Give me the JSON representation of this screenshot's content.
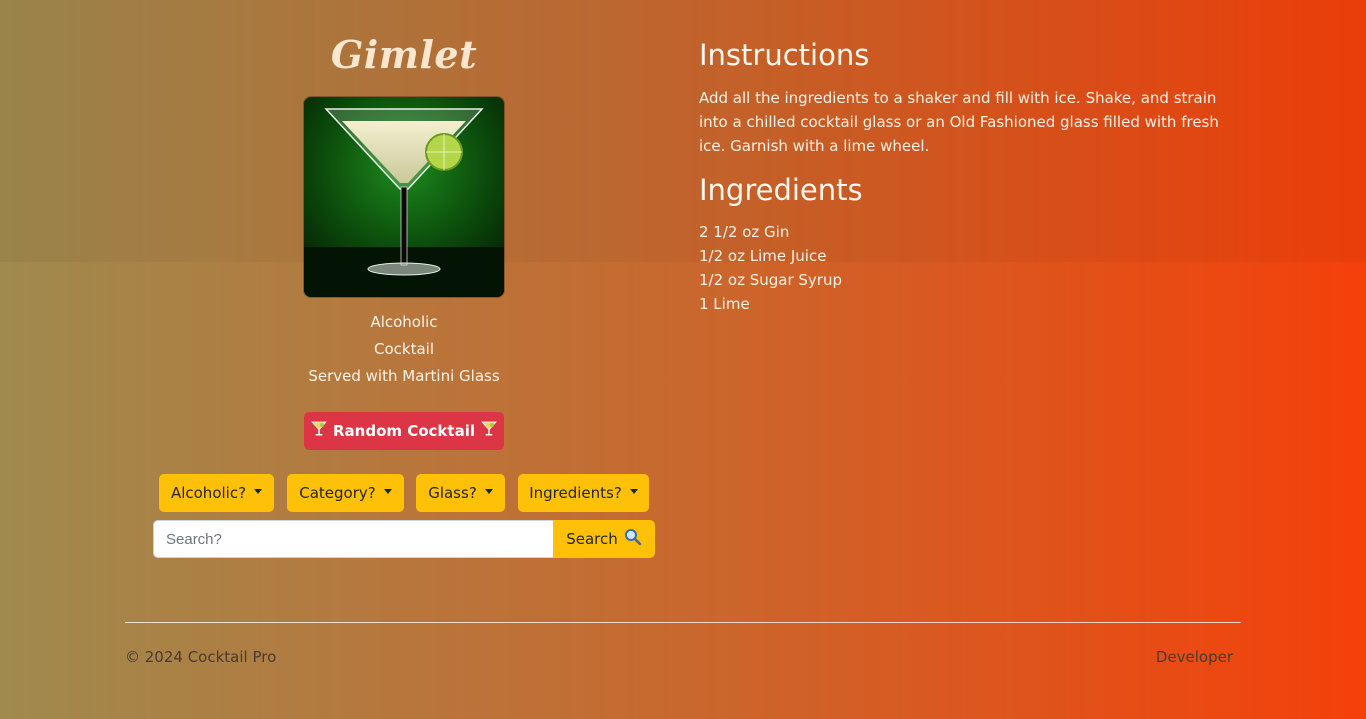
{
  "drink": {
    "name": "Gimlet",
    "alcoholic": "Alcoholic",
    "category": "Cocktail",
    "glass": "Served with Martini Glass"
  },
  "actions": {
    "random_label": "Random Cocktail",
    "random_icon": "cocktail-glass-icon",
    "search_label": "Search",
    "search_icon": "magnifier-icon"
  },
  "filters": {
    "alcoholic": "Alcoholic?",
    "category": "Category?",
    "glass": "Glass?",
    "ingredients": "Ingredients?"
  },
  "search": {
    "placeholder": "Search?",
    "value": ""
  },
  "instructions": {
    "heading": "Instructions",
    "text": "Add all the ingredients to a shaker and fill with ice. Shake, and strain into a chilled cocktail glass or an Old Fashioned glass filled with fresh ice. Garnish with a lime wheel."
  },
  "ingredients": {
    "heading": "Ingredients",
    "items": [
      "2 1/2 oz Gin",
      "1/2 oz Lime Juice",
      "1/2 oz Sugar Syrup",
      "1 Lime"
    ]
  },
  "footer": {
    "copyright": "© 2024 Cocktail Pro",
    "developer_label": "Developer"
  },
  "colors": {
    "random_button": "#dc3545",
    "filter_button": "#ffc107",
    "gradient_start": "#a08a4e",
    "gradient_end": "#f5400a"
  }
}
